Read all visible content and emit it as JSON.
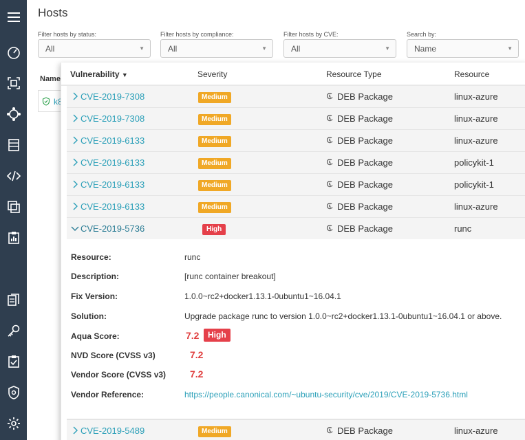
{
  "page": {
    "title": "Hosts"
  },
  "filters": [
    {
      "label": "Filter hosts by status:",
      "value": "All"
    },
    {
      "label": "Filter hosts by compliance:",
      "value": "All"
    },
    {
      "label": "Filter hosts by CVE:",
      "value": "All"
    },
    {
      "label": "Search by:",
      "value": "Name"
    }
  ],
  "hosts_table": {
    "name_header": "Name",
    "first_host_partial": "k8"
  },
  "vuln_table": {
    "headers": {
      "vulnerability": "Vulnerability",
      "severity": "Severity",
      "resource_type": "Resource Type",
      "resource": "Resource"
    },
    "rows": [
      {
        "cve": "CVE-2019-7308",
        "severity": "Medium",
        "resource_type": "DEB Package",
        "resource": "linux-azure"
      },
      {
        "cve": "CVE-2019-7308",
        "severity": "Medium",
        "resource_type": "DEB Package",
        "resource": "linux-azure"
      },
      {
        "cve": "CVE-2019-6133",
        "severity": "Medium",
        "resource_type": "DEB Package",
        "resource": "linux-azure"
      },
      {
        "cve": "CVE-2019-6133",
        "severity": "Medium",
        "resource_type": "DEB Package",
        "resource": "policykit-1"
      },
      {
        "cve": "CVE-2019-6133",
        "severity": "Medium",
        "resource_type": "DEB Package",
        "resource": "policykit-1"
      },
      {
        "cve": "CVE-2019-6133",
        "severity": "Medium",
        "resource_type": "DEB Package",
        "resource": "linux-azure"
      },
      {
        "cve": "CVE-2019-5736",
        "severity": "High",
        "resource_type": "DEB Package",
        "resource": "runc"
      }
    ],
    "last_row": {
      "cve": "CVE-2019-5489",
      "severity": "Medium",
      "resource_type": "DEB Package",
      "resource": "linux-azure"
    }
  },
  "detail": {
    "resource_label": "Resource:",
    "resource_value": "runc",
    "description_label": "Description:",
    "description_value": "[runc container breakout]",
    "fix_label": "Fix Version:",
    "fix_value": "1.0.0~rc2+docker1.13.1-0ubuntu1~16.04.1",
    "solution_label": "Solution:",
    "solution_value": "Upgrade package runc to version 1.0.0~rc2+docker1.13.1-0ubuntu1~16.04.1 or above.",
    "aqua_label": "Aqua Score:",
    "aqua_value": "7.2",
    "aqua_badge": "High",
    "nvd_label": "NVD Score (CVSS v3)",
    "nvd_value": "7.2",
    "vendor_score_label": "Vendor Score (CVSS v3)",
    "vendor_score_value": "7.2",
    "vendor_ref_label": "Vendor Reference:",
    "vendor_ref_value": "https://people.canonical.com/~ubuntu-security/cve/2019/CVE-2019-5736.html"
  },
  "colors": {
    "sidebar": "#2f3e4f",
    "link": "#2a9fb8",
    "medium": "#f0a826",
    "high": "#e5404a"
  },
  "sidebar_icons": [
    "menu-icon",
    "dashboard-icon",
    "images-icon",
    "hosts-icon",
    "containers-icon",
    "code-icon",
    "services-icon",
    "reports-icon",
    "policies-icon",
    "keys-icon",
    "compliance-icon",
    "security-icon",
    "settings-icon"
  ]
}
